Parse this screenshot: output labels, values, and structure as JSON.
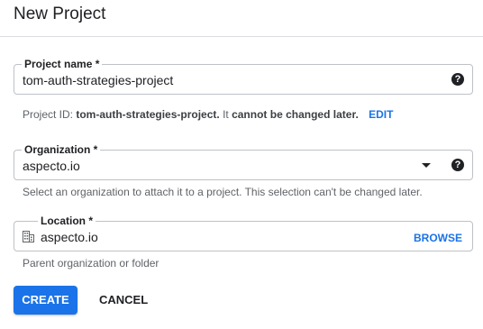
{
  "dialog": {
    "title": "New Project"
  },
  "project_name": {
    "label": "Project name *",
    "value": "tom-auth-strategies-project",
    "help_icon": "help-icon"
  },
  "project_id_hint": {
    "prefix": "Project ID:",
    "id": "tom-auth-strategies-project.",
    "middle": "It",
    "emphasis": "cannot be changed later.",
    "edit_label": "EDIT"
  },
  "organization": {
    "label": "Organization *",
    "value": "aspecto.io",
    "dropdown_icon": "dropdown-arrow-icon",
    "help_icon": "help-icon",
    "hint": "Select an organization to attach it to a project. This selection can't be changed later."
  },
  "location": {
    "label": "Location *",
    "value": "aspecto.io",
    "icon": "building-icon",
    "browse_label": "BROWSE",
    "hint": "Parent organization or folder"
  },
  "actions": {
    "create_label": "CREATE",
    "cancel_label": "CANCEL"
  },
  "colors": {
    "primary": "#1a73e8",
    "text": "#202124",
    "hint": "#5f6368",
    "border": "#bdc1c6"
  }
}
